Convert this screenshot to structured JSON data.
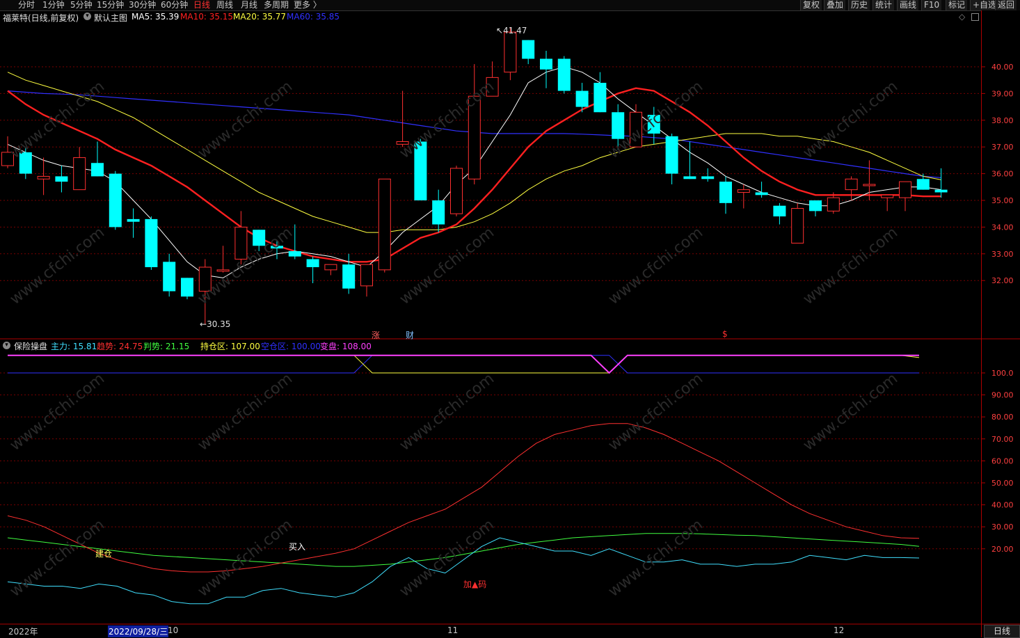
{
  "toolbar": {
    "periods": [
      "分时",
      "1分钟",
      "5分钟",
      "15分钟",
      "30分钟",
      "60分钟",
      "日线",
      "周线",
      "月线",
      "多周期",
      "更多 〉"
    ],
    "active_period": "日线",
    "right_buttons": [
      "复权",
      "叠加",
      "历史",
      "统计",
      "画线",
      "F10",
      "标记",
      "+自选",
      "返回"
    ]
  },
  "main_panel": {
    "stock": "福莱特(日线,前复权)",
    "template": "默认主图",
    "ma": [
      {
        "label": "MA5: 35.39",
        "color": "#ffffff"
      },
      {
        "label": "MA10: 35.15",
        "color": "#ff2020"
      },
      {
        "label": "MA20: 35.77",
        "color": "#ffff40"
      },
      {
        "label": "MA60: 35.85",
        "color": "#3030ff"
      }
    ],
    "high_mark": "41.47",
    "low_mark": "30.35",
    "y_ticks": [
      "40.00",
      "39.00",
      "38.00",
      "37.00",
      "36.00",
      "35.00",
      "34.00",
      "33.00",
      "32.00"
    ],
    "markers": [
      {
        "text": "涨",
        "color": "#ff6060"
      },
      {
        "text": "财",
        "color": "#80c0ff"
      },
      {
        "text": "$",
        "color": "#ff3030"
      }
    ]
  },
  "sub_panel": {
    "indicator": "保险操盘",
    "values": [
      {
        "label": "主力: 15.81",
        "color": "#40e0ff"
      },
      {
        "label": "趋势: 24.75",
        "color": "#ff3030"
      },
      {
        "label": "判势: 21.15",
        "color": "#40ff40"
      },
      {
        "label": "持仓区: 107.00",
        "color": "#ffff40"
      },
      {
        "label": "空仓区: 100.00",
        "color": "#3030ff"
      },
      {
        "label": "变盘: 108.00",
        "color": "#ff40ff"
      }
    ],
    "y_ticks": [
      "100.0",
      "90.00",
      "80.00",
      "70.00",
      "60.00",
      "50.00",
      "40.00",
      "30.00",
      "20.00"
    ],
    "annotations": [
      {
        "text": "建仓",
        "color": "#ffff60"
      },
      {
        "text": "买入",
        "color": "#ffffff"
      },
      {
        "text": "加▲码",
        "color": "#ff3030"
      }
    ]
  },
  "date_axis": {
    "year": "2022年",
    "cursor_date": "2022/09/28/三",
    "after_cursor": "10",
    "months": [
      "11",
      "12"
    ],
    "period_button": "日线"
  },
  "watermark": "www.cfchi.com",
  "colors": {
    "up": "#ff3030",
    "down": "#00ffff",
    "grid": "#7a0000",
    "border": "#b00000"
  },
  "chart_data": {
    "type": "candlestick",
    "candles": [
      {
        "o": 36.3,
        "h": 37.4,
        "l": 36.2,
        "c": 36.8
      },
      {
        "o": 36.8,
        "h": 37.0,
        "l": 35.8,
        "c": 36.0
      },
      {
        "o": 35.8,
        "h": 36.6,
        "l": 35.2,
        "c": 35.9
      },
      {
        "o": 35.9,
        "h": 36.3,
        "l": 35.3,
        "c": 35.7
      },
      {
        "o": 35.4,
        "h": 37.0,
        "l": 35.4,
        "c": 36.6
      },
      {
        "o": 36.4,
        "h": 37.2,
        "l": 35.9,
        "c": 35.9
      },
      {
        "o": 36.0,
        "h": 36.1,
        "l": 33.9,
        "c": 34.0
      },
      {
        "o": 34.3,
        "h": 34.7,
        "l": 33.6,
        "c": 34.2
      },
      {
        "o": 34.3,
        "h": 34.4,
        "l": 32.4,
        "c": 32.5
      },
      {
        "o": 32.7,
        "h": 33.0,
        "l": 31.4,
        "c": 31.6
      },
      {
        "o": 32.1,
        "h": 32.1,
        "l": 31.3,
        "c": 31.4
      },
      {
        "o": 31.6,
        "h": 32.8,
        "l": 30.35,
        "c": 32.5
      },
      {
        "o": 32.4,
        "h": 33.3,
        "l": 32.3,
        "c": 32.4
      },
      {
        "o": 32.8,
        "h": 34.6,
        "l": 32.6,
        "c": 34.0
      },
      {
        "o": 33.9,
        "h": 33.9,
        "l": 33.1,
        "c": 33.3
      },
      {
        "o": 33.3,
        "h": 33.5,
        "l": 32.8,
        "c": 33.2
      },
      {
        "o": 33.1,
        "h": 34.1,
        "l": 32.8,
        "c": 32.9
      },
      {
        "o": 32.8,
        "h": 32.9,
        "l": 31.9,
        "c": 32.5
      },
      {
        "o": 32.4,
        "h": 32.6,
        "l": 32.2,
        "c": 32.6
      },
      {
        "o": 32.6,
        "h": 33.0,
        "l": 31.5,
        "c": 31.7
      },
      {
        "o": 31.8,
        "h": 32.6,
        "l": 31.4,
        "c": 32.6
      },
      {
        "o": 32.4,
        "h": 35.8,
        "l": 32.3,
        "c": 35.8
      },
      {
        "o": 37.1,
        "h": 39.1,
        "l": 37.0,
        "c": 37.2
      },
      {
        "o": 37.2,
        "h": 37.3,
        "l": 35.0,
        "c": 35.0
      },
      {
        "o": 35.0,
        "h": 35.4,
        "l": 33.8,
        "c": 34.1
      },
      {
        "o": 34.5,
        "h": 36.3,
        "l": 34.4,
        "c": 36.2
      },
      {
        "o": 35.8,
        "h": 40.1,
        "l": 35.6,
        "c": 38.9
      },
      {
        "o": 38.9,
        "h": 40.2,
        "l": 38.9,
        "c": 39.6
      },
      {
        "o": 39.8,
        "h": 41.47,
        "l": 39.5,
        "c": 41.3
      },
      {
        "o": 41.0,
        "h": 41.0,
        "l": 40.1,
        "c": 40.3
      },
      {
        "o": 40.3,
        "h": 40.6,
        "l": 39.2,
        "c": 39.9
      },
      {
        "o": 40.3,
        "h": 40.4,
        "l": 39.0,
        "c": 39.1
      },
      {
        "o": 39.1,
        "h": 39.4,
        "l": 38.3,
        "c": 38.5
      },
      {
        "o": 39.4,
        "h": 39.8,
        "l": 38.3,
        "c": 38.3
      },
      {
        "o": 38.3,
        "h": 38.6,
        "l": 36.9,
        "c": 37.3
      },
      {
        "o": 37.0,
        "h": 38.6,
        "l": 37.0,
        "c": 38.3
      },
      {
        "o": 38.2,
        "h": 38.5,
        "l": 37.1,
        "c": 37.5
      },
      {
        "o": 37.4,
        "h": 37.5,
        "l": 35.6,
        "c": 36.0
      },
      {
        "o": 35.9,
        "h": 37.2,
        "l": 35.8,
        "c": 35.8
      },
      {
        "o": 35.9,
        "h": 36.2,
        "l": 35.7,
        "c": 35.8
      },
      {
        "o": 35.7,
        "h": 35.9,
        "l": 34.5,
        "c": 34.9
      },
      {
        "o": 35.3,
        "h": 35.6,
        "l": 34.7,
        "c": 35.4
      },
      {
        "o": 35.3,
        "h": 35.7,
        "l": 35.1,
        "c": 35.2
      },
      {
        "o": 34.8,
        "h": 34.9,
        "l": 34.1,
        "c": 34.4
      },
      {
        "o": 33.4,
        "h": 34.9,
        "l": 33.4,
        "c": 34.7
      },
      {
        "o": 35.0,
        "h": 35.0,
        "l": 34.4,
        "c": 34.6
      },
      {
        "o": 34.6,
        "h": 35.3,
        "l": 34.5,
        "c": 35.1
      },
      {
        "o": 35.4,
        "h": 35.9,
        "l": 35.0,
        "c": 35.8
      },
      {
        "o": 35.6,
        "h": 36.5,
        "l": 35.0,
        "c": 35.6
      },
      {
        "o": 35.1,
        "h": 35.2,
        "l": 34.6,
        "c": 35.2
      },
      {
        "o": 35.1,
        "h": 35.7,
        "l": 34.6,
        "c": 35.7
      },
      {
        "o": 35.8,
        "h": 36.0,
        "l": 35.4,
        "c": 35.4
      },
      {
        "o": 35.4,
        "h": 36.2,
        "l": 35.1,
        "c": 35.3
      }
    ],
    "ma5": [
      37.1,
      36.8,
      36.5,
      36.3,
      36.2,
      36.1,
      35.7,
      35.0,
      34.3,
      33.5,
      32.7,
      32.2,
      32.1,
      32.5,
      32.8,
      33.0,
      33.1,
      33.0,
      32.9,
      32.7,
      32.5,
      33.1,
      33.8,
      34.3,
      34.8,
      35.6,
      36.2,
      37.2,
      38.2,
      39.4,
      39.8,
      40.0,
      39.8,
      39.4,
      38.8,
      38.3,
      37.8,
      37.3,
      36.8,
      36.4,
      35.9,
      35.6,
      35.3,
      35.1,
      34.9,
      34.8,
      34.8,
      35.0,
      35.3,
      35.4,
      35.5,
      35.5,
      35.4
    ],
    "ma10": [
      39.1,
      38.6,
      38.2,
      37.9,
      37.6,
      37.3,
      36.9,
      36.6,
      36.3,
      35.9,
      35.5,
      35.0,
      34.5,
      34.0,
      33.6,
      33.3,
      33.1,
      32.9,
      32.8,
      32.7,
      32.7,
      32.8,
      33.2,
      33.6,
      33.8,
      34.1,
      34.7,
      35.4,
      36.2,
      37.0,
      37.6,
      38.0,
      38.4,
      38.7,
      39.0,
      39.2,
      39.1,
      38.7,
      38.3,
      37.8,
      37.2,
      36.6,
      36.1,
      35.7,
      35.4,
      35.2,
      35.2,
      35.2,
      35.2,
      35.2,
      35.2,
      35.15,
      35.15
    ],
    "ma20": [
      39.8,
      39.5,
      39.3,
      39.1,
      38.9,
      38.7,
      38.4,
      38.1,
      37.7,
      37.3,
      36.9,
      36.5,
      36.1,
      35.7,
      35.3,
      35.0,
      34.7,
      34.4,
      34.2,
      34.0,
      33.8,
      33.8,
      33.9,
      33.9,
      33.9,
      34.0,
      34.2,
      34.5,
      34.9,
      35.4,
      35.8,
      36.1,
      36.3,
      36.6,
      36.8,
      37.0,
      37.1,
      37.2,
      37.3,
      37.4,
      37.5,
      37.5,
      37.5,
      37.4,
      37.4,
      37.3,
      37.2,
      37.0,
      36.8,
      36.5,
      36.2,
      35.9,
      35.77
    ],
    "ma60": [
      39.1,
      39.05,
      39.0,
      38.98,
      38.95,
      38.9,
      38.85,
      38.8,
      38.75,
      38.7,
      38.65,
      38.6,
      38.55,
      38.5,
      38.45,
      38.4,
      38.35,
      38.3,
      38.25,
      38.2,
      38.1,
      38.0,
      37.9,
      37.8,
      37.7,
      37.6,
      37.55,
      37.5,
      37.5,
      37.5,
      37.5,
      37.5,
      37.48,
      37.45,
      37.42,
      37.4,
      37.35,
      37.3,
      37.2,
      37.1,
      37.0,
      36.9,
      36.8,
      36.7,
      36.6,
      36.5,
      36.4,
      36.3,
      36.2,
      36.1,
      36.0,
      35.9,
      35.85
    ],
    "sub": {
      "trend": [
        35,
        33,
        30,
        26,
        22,
        18,
        15,
        13,
        11,
        10,
        9.5,
        9.5,
        10,
        11,
        12,
        13.5,
        15,
        16.5,
        18,
        20,
        24,
        28,
        32,
        35,
        38,
        43,
        48,
        55,
        62,
        68,
        72,
        74,
        76,
        77,
        77,
        75,
        72,
        68,
        64,
        60,
        55,
        50,
        45,
        40,
        36,
        33,
        30,
        28,
        26,
        25,
        24.75
      ],
      "judge": [
        25,
        24,
        23,
        22,
        21,
        20,
        19,
        18,
        17,
        16.5,
        16,
        15.5,
        15,
        14.5,
        14,
        13.5,
        13,
        12.5,
        12,
        12,
        12.5,
        13,
        14,
        15,
        16,
        17.5,
        19,
        20.5,
        22,
        23,
        24,
        25,
        25.5,
        26,
        26.5,
        27,
        27,
        27,
        26.8,
        26.5,
        26.2,
        26,
        25.5,
        25,
        24.5,
        24,
        23.5,
        23,
        22.5,
        22,
        21.15
      ],
      "main": [
        5,
        4,
        3,
        3,
        2,
        4,
        3,
        0,
        -1,
        -4,
        -5,
        -5,
        -2,
        -2,
        1,
        2,
        0,
        -1,
        -2,
        0,
        5,
        12,
        16,
        11,
        9,
        15,
        21,
        25,
        23,
        21,
        19,
        19,
        17,
        20,
        17,
        14,
        14,
        15,
        13,
        13,
        12,
        13,
        13,
        14,
        17,
        16,
        15,
        17,
        16,
        16,
        15.81
      ],
      "hold": [
        108,
        108,
        108,
        108,
        108,
        108,
        108,
        108,
        108,
        108,
        108,
        108,
        108,
        108,
        108,
        108,
        108,
        108,
        108,
        108,
        100,
        100,
        100,
        100,
        100,
        100,
        100,
        100,
        100,
        100,
        100,
        100,
        100,
        100,
        108,
        108,
        108,
        108,
        108,
        108,
        108,
        108,
        108,
        108,
        108,
        108,
        108,
        108,
        108,
        108,
        107
      ],
      "empty": [
        100,
        100,
        100,
        100,
        100,
        100,
        100,
        100,
        100,
        100,
        100,
        100,
        100,
        100,
        100,
        100,
        100,
        100,
        100,
        100,
        108,
        108,
        108,
        108,
        108,
        108,
        108,
        108,
        108,
        108,
        108,
        108,
        108,
        108,
        100,
        100,
        100,
        100,
        100,
        100,
        100,
        100,
        100,
        100,
        100,
        100,
        100,
        100,
        100,
        100,
        100
      ],
      "change": [
        108,
        108,
        108,
        108,
        108,
        108,
        108,
        108,
        108,
        108,
        108,
        108,
        108,
        108,
        108,
        108,
        108,
        108,
        108,
        108,
        108,
        108,
        108,
        108,
        108,
        108,
        108,
        108,
        108,
        108,
        108,
        108,
        108,
        100,
        108,
        108,
        108,
        108,
        108,
        108,
        108,
        108,
        108,
        108,
        108,
        108,
        108,
        108,
        108,
        108,
        108
      ]
    }
  }
}
